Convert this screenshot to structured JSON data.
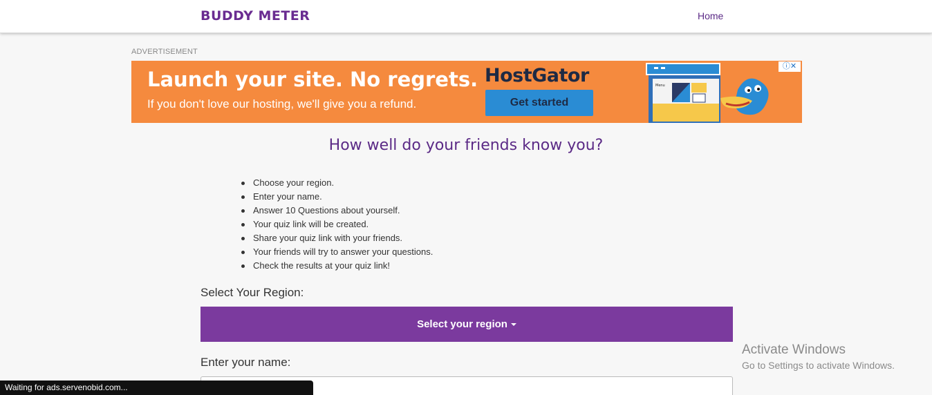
{
  "nav": {
    "brand": "BUDDY METER",
    "home": "Home"
  },
  "ad": {
    "label": "ADVERTISEMENT",
    "headline": "Launch your site. No regrets.",
    "subline": "If you don't love our hosting, we'll give you a refund.",
    "brand": "HostGator",
    "cta": "Get started",
    "choices": "ⓘ✕",
    "illustration_menu": "Menu",
    "background_color": "#f58a3e"
  },
  "main": {
    "title": "How well do your friends know you?",
    "steps": [
      "Choose your region.",
      "Enter your name.",
      "Answer 10 Questions about yourself.",
      "Your quiz link will be created.",
      "Share your quiz link with your friends.",
      "Your friends will try to answer your questions.",
      "Check the results at your quiz link!"
    ],
    "region_label": "Select Your Region:",
    "region_button": "Select your region",
    "name_label": "Enter your name:",
    "name_value": "",
    "accent_color": "#7b3a9e"
  },
  "windows": {
    "title": "Activate Windows",
    "subtitle": "Go to Settings to activate Windows."
  },
  "status": {
    "text": "Waiting for ads.servenobid.com..."
  }
}
